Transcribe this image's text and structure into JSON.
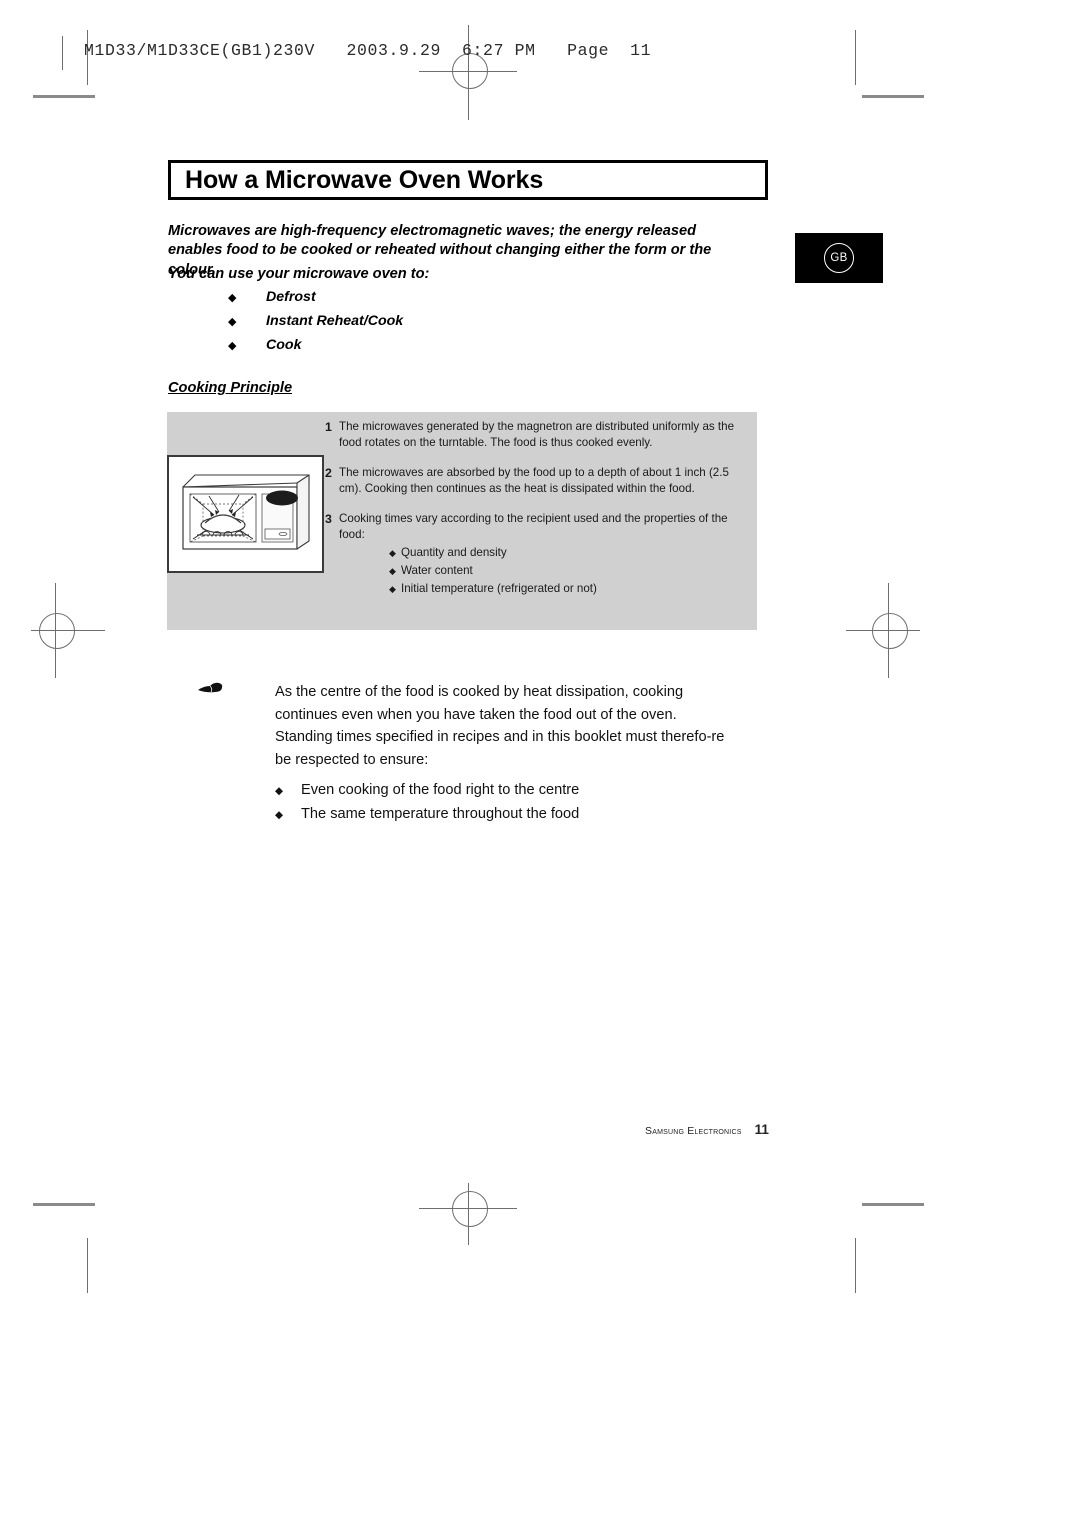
{
  "print_banner": "M1D33/M1D33CE(GB1)230V   2003.9.29  6:27 PM   Page  11",
  "title": "How a Microwave Oven Works",
  "intro": "Microwaves are high-frequency electromagnetic waves; the energy released enables food to be cooked or reheated without changing either the form or the colour.",
  "lead_in": "You can use your microwave oven to:",
  "features": [
    {
      "bullet": "◆",
      "label": "Defrost"
    },
    {
      "bullet": "◆",
      "label": "Instant Reheat/Cook"
    },
    {
      "bullet": "◆",
      "label": "Cook"
    }
  ],
  "subhead": "Cooking Principle",
  "steps": [
    {
      "number": "1",
      "text": "The microwaves generated by the magnetron are distributed uniformly as the food rotates on the turntable. The food is thus cooked evenly."
    },
    {
      "number": "2",
      "text": "The microwaves are absorbed by the food up to a depth of about 1 inch (2.5 cm). Cooking then continues as the heat is dissipated within the food."
    },
    {
      "number": "3",
      "text": "Cooking times vary according to the recipient used and the properties of the food:",
      "sub_items": [
        {
          "bullet": "◆",
          "label": "Quantity and density"
        },
        {
          "bullet": "◆",
          "label": "Water content"
        },
        {
          "bullet": "◆",
          "label": "Initial temperature (refrigerated or not)"
        }
      ]
    }
  ],
  "illustration": {
    "name": "microwave-oven-cutaway",
    "description": "Cutaway drawing of a microwave oven showing microwaves reflecting onto food on the turntable"
  },
  "note": {
    "icon": "pointing-hand",
    "text": "As the centre of the food is cooked by heat dissipation, cooking continues even when you have taken the food out of the oven. Standing times specified in recipes and in this booklet must therefo-re be respected to ensure:",
    "bullets": [
      {
        "bullet": "◆",
        "label": "Even cooking of the food right to the centre"
      },
      {
        "bullet": "◆",
        "label": "The same temperature throughout the food"
      }
    ]
  },
  "region_badge": "GB",
  "footer": {
    "brand": "Samsung Electronics",
    "page_number": "11"
  },
  "colors": {
    "panel_grey": "#d0d0d0",
    "ink": "#000000",
    "badge_black": "#000000",
    "crop_mark": "#6e6e6e"
  }
}
